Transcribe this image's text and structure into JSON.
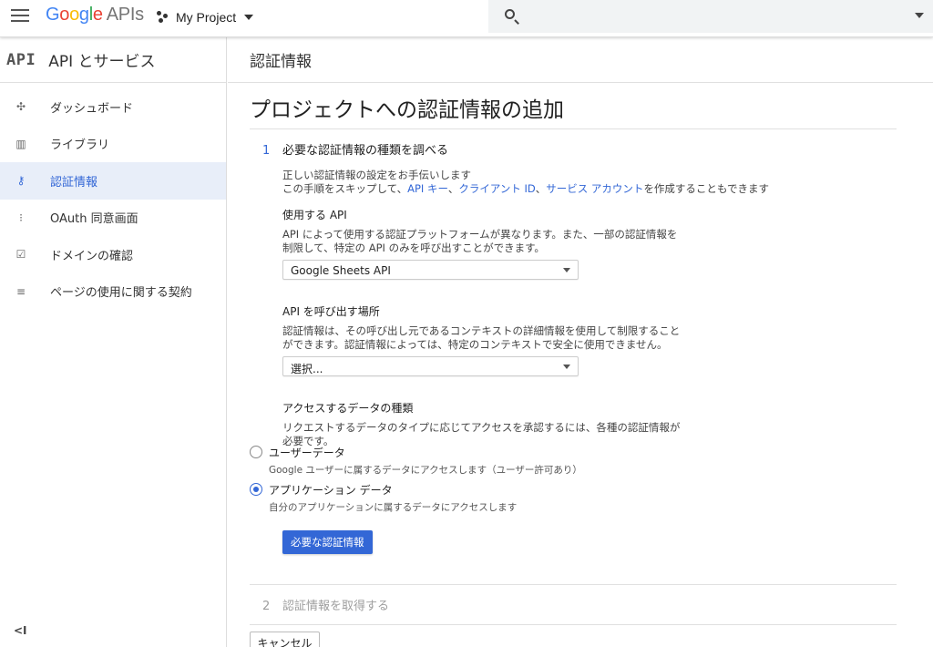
{
  "topbar": {
    "logo_google": [
      "G",
      "o",
      "o",
      "g",
      "l",
      "e"
    ],
    "logo_apis": "APIs",
    "project_name": "My Project"
  },
  "sidebar": {
    "badge": "API",
    "title": "API とサービス",
    "items": [
      {
        "label": "ダッシュボード",
        "icon": "dashboard-icon",
        "glyph": "✣"
      },
      {
        "label": "ライブラリ",
        "icon": "library-icon",
        "glyph": "▥"
      },
      {
        "label": "認証情報",
        "icon": "key-icon",
        "glyph": "⚷"
      },
      {
        "label": "OAuth 同意画面",
        "icon": "oauth-consent-icon",
        "glyph": "⁝"
      },
      {
        "label": "ドメインの確認",
        "icon": "checkbox-icon",
        "glyph": "☑"
      },
      {
        "label": "ページの使用に関する契約",
        "icon": "settings-list-icon",
        "glyph": "≡"
      }
    ],
    "active_index": 2,
    "collapse": "<I"
  },
  "main": {
    "page_title": "認証情報",
    "heading": "プロジェクトへの認証情報の追加",
    "step1": {
      "num": "1",
      "title": "必要な認証情報の種類を調べる",
      "intro1": "正しい認証情報の設定をお手伝いします",
      "intro2_pre": "この手順をスキップして、",
      "link_api_key": "API キー",
      "sep1": "、",
      "link_client_id": "クライアント ID",
      "sep2": "、",
      "link_service_account": "サービス アカウント",
      "intro2_post": "を作成することもできます",
      "api_title": "使用する API",
      "api_desc": "API によって使用する認証プラットフォームが異なります。また、一部の認証情報を制限して、特定の API のみを呼び出すことができます。",
      "api_select": "Google Sheets API",
      "where_title": "API を呼び出す場所",
      "where_desc": "認証情報は、その呼び出し元であるコンテキストの詳細情報を使用して制限することができます。認証情報によっては、特定のコンテキストで安全に使用できません。",
      "where_select": "選択...",
      "data_title": "アクセスするデータの種類",
      "data_desc": "リクエストするデータのタイプに応じてアクセスを承認するには、各種の認証情報が必要です。",
      "radio_user": "ユーザーデータ",
      "radio_user_sub": "Google ユーザーに属するデータにアクセスします（ユーザー許可あり）",
      "radio_app": "アプリケーション データ",
      "radio_app_sub": "自分のアプリケーションに属するデータにアクセスします",
      "button": "必要な認証情報"
    },
    "step2": {
      "num": "2",
      "title": "認証情報を取得する"
    },
    "cancel": "キャンセル"
  },
  "colors": {
    "accent": "#3367d6",
    "active_bg": "#e8eef9"
  }
}
